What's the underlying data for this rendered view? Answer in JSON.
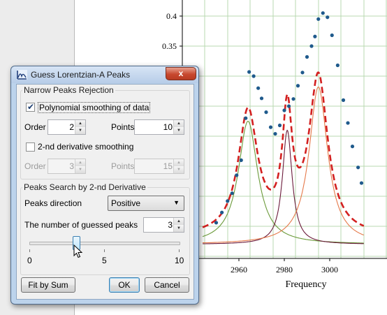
{
  "dialog": {
    "title": "Guess Lorentzian-A Peaks",
    "close_label": "x",
    "narrow_group": {
      "title": "Narrow Peaks Rejection",
      "poly_smoothing": {
        "label": "Polynomial smoothing of data",
        "checked": true
      },
      "order": {
        "label": "Order",
        "value": "2"
      },
      "points": {
        "label": "Points",
        "value": "10"
      },
      "deriv_smoothing": {
        "label": "2-nd derivative smoothing",
        "checked": false
      },
      "order2": {
        "label": "Order",
        "value": "3"
      },
      "points2": {
        "label": "Points",
        "value": "15"
      }
    },
    "search_group": {
      "title": "Peaks Search by 2-nd Derivative",
      "direction": {
        "label": "Peaks direction",
        "value": "Positive"
      },
      "guessed": {
        "label": "The number of guessed peaks",
        "value": "3"
      },
      "slider": {
        "min_label": "0",
        "mid_label": "5",
        "max_label": "10",
        "value": 3
      }
    },
    "buttons": {
      "fit_by_sum": "Fit by Sum",
      "ok": "OK",
      "cancel": "Cancel"
    }
  },
  "plot": {
    "y_ticks": [
      "0.4",
      "0.35"
    ],
    "x_ticks": [
      "2960",
      "2980",
      "3000"
    ],
    "xlabel": "Frequency",
    "colors": {
      "dots": "#1f5a8c",
      "fit_total": "#d32020",
      "peak1": "#6b9a3a",
      "peak2": "#6a1a3a",
      "peak3": "#e5794a",
      "grid": "#b9d9b0"
    }
  }
}
